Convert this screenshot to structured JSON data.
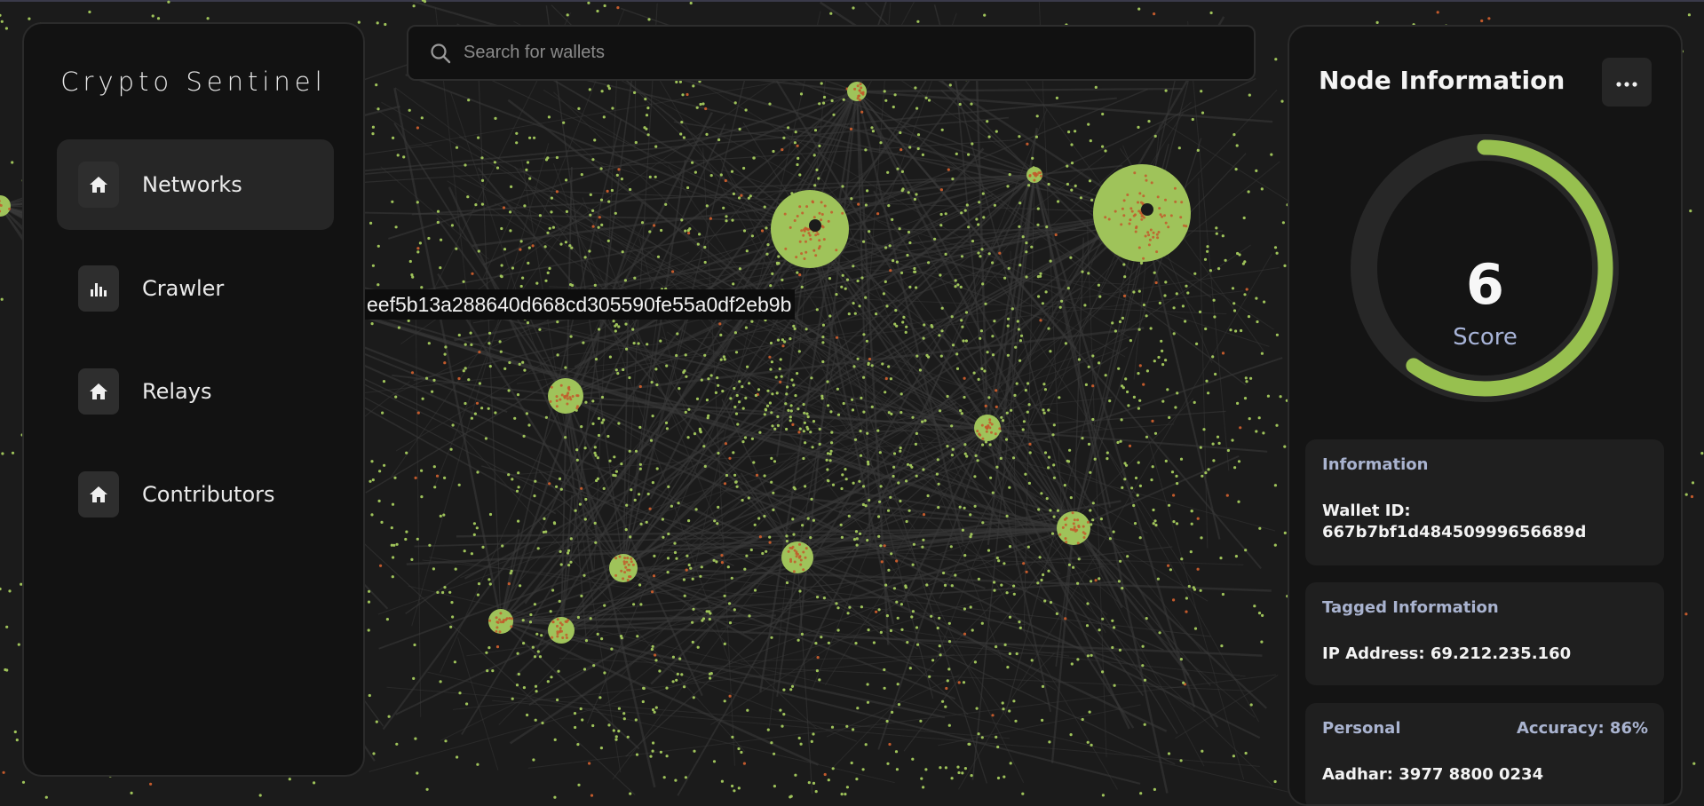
{
  "app": {
    "title": "Crypto Sentinel"
  },
  "sidebar": {
    "items": [
      {
        "label": "Networks",
        "icon": "home-icon",
        "active": true
      },
      {
        "label": "Crawler",
        "icon": "bar-chart-icon",
        "active": false
      },
      {
        "label": "Relays",
        "icon": "home-icon",
        "active": false
      },
      {
        "label": "Contributors",
        "icon": "home-icon",
        "active": false
      }
    ]
  },
  "search": {
    "placeholder": "Search for wallets",
    "value": ""
  },
  "graph": {
    "hover_label": "eef5b13a288640d668cd305590fe55a0df2eb9b"
  },
  "panel": {
    "title": "Node Information",
    "menu_icon": "more-horizontal-icon",
    "score": {
      "value": "6",
      "label": "Score",
      "fraction": 0.6,
      "color": "#97c04f",
      "track_color": "#272727"
    },
    "information": {
      "title": "Information",
      "wallet_label": "Wallet ID:",
      "wallet_id": "667b7bf1d48450999656689d"
    },
    "tagged": {
      "title": "Tagged Information",
      "ip": "IP Address: 69.212.235.160"
    },
    "personal": {
      "title": "Personal",
      "accuracy": "Accuracy: 86%",
      "aadhar": "Aadhar: 3977 8800 0234"
    }
  },
  "colors": {
    "node": "#9fc35a",
    "node_alt": "#c25a2c",
    "edge": "#3a3a3a",
    "background": "#1b1b1b"
  }
}
